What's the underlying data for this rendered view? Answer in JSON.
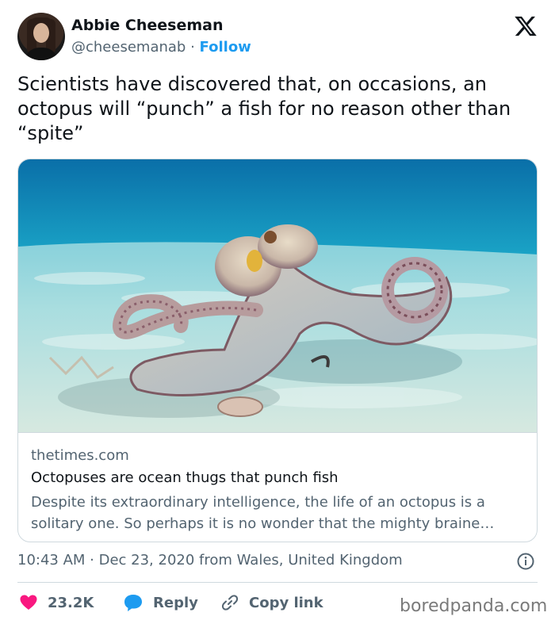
{
  "author": {
    "name": "Abbie Cheeseman",
    "handle": "@cheesemanab",
    "separator": "·",
    "follow_label": "Follow",
    "avatar_icon": "avatar-photo"
  },
  "platform_icon": "x-logo-icon",
  "tweet": {
    "text": "Scientists have discovered that, on occasions, an octopus will “punch” a fish for no reason other than “spite”"
  },
  "card": {
    "image_alt": "octopus-on-sandy-seafloor",
    "domain": "thetimes.com",
    "title": "Octopuses are ocean thugs that punch fish",
    "description": "Despite its extraordinary intelligence, the life of an octopus is a solitary one. So perhaps it is no wonder that the mighty braine…"
  },
  "meta": {
    "text": "10:43 AM · Dec 23, 2020 from Wales, United Kingdom"
  },
  "actions": {
    "like_count": "23.2K",
    "reply_label": "Reply",
    "copy_label": "Copy link"
  },
  "watermark": "boredpanda.com",
  "colors": {
    "accent": "#1d9bf0",
    "like": "#f91880",
    "text": "#0f1419",
    "muted": "#536471",
    "border": "#cfd9de"
  }
}
